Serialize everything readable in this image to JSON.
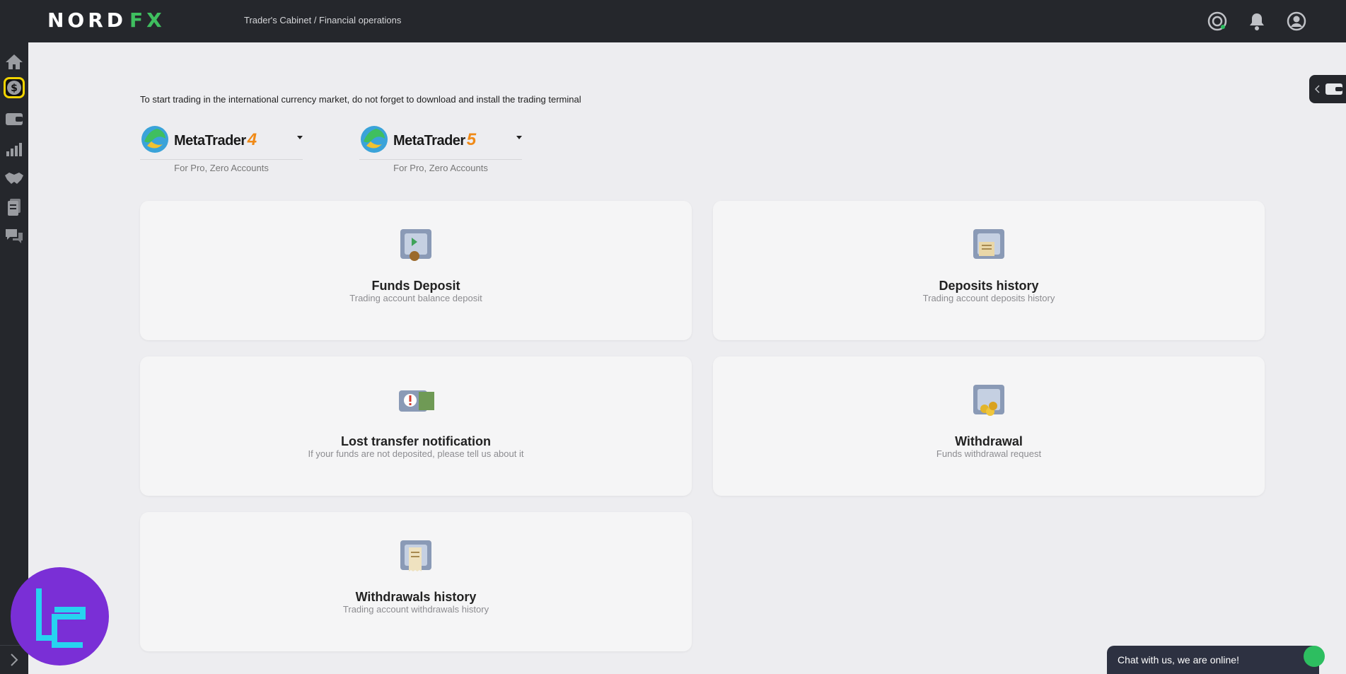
{
  "header": {
    "logo_main": "NORD",
    "logo_accent": "FX",
    "breadcrumb": "Trader's Cabinet / Financial operations",
    "icons": [
      "support-icon",
      "bell-icon",
      "user-icon"
    ]
  },
  "sidebar": {
    "items": [
      {
        "name": "home-icon",
        "active": false
      },
      {
        "name": "dollar-icon",
        "active": true
      },
      {
        "name": "wallet-icon",
        "active": false
      },
      {
        "name": "chart-icon",
        "active": false
      },
      {
        "name": "handshake-icon",
        "active": false
      },
      {
        "name": "documents-icon",
        "active": false
      },
      {
        "name": "chat-icon",
        "active": false
      }
    ],
    "expand_icon": "chevron-right-icon",
    "highlight_color": "#f2d400"
  },
  "main": {
    "intro": "To start trading in the international currency market, do not forget to download and install the trading terminal",
    "terminals": [
      {
        "name": "MetaTrader",
        "version": "4",
        "subtitle": "For Pro, Zero Accounts"
      },
      {
        "name": "MetaTrader",
        "version": "5",
        "subtitle": "For Pro, Zero Accounts"
      }
    ],
    "cards": [
      {
        "title": "Funds Deposit",
        "subtitle": "Trading account balance deposit",
        "icon": "safe-deposit-icon"
      },
      {
        "title": "Deposits history",
        "subtitle": "Trading account deposits history",
        "icon": "safe-documents-icon"
      },
      {
        "title": "Lost transfer notification",
        "subtitle": "If your funds are not deposited, please tell us about it",
        "icon": "safe-alert-icon"
      },
      {
        "title": "Withdrawal",
        "subtitle": "Funds withdrawal request",
        "icon": "safe-coins-icon"
      },
      {
        "title": "Withdrawals history",
        "subtitle": "Trading account withdrawals history",
        "icon": "safe-receipt-icon"
      }
    ]
  },
  "chat": {
    "label": "Chat with us, we are online!"
  },
  "colors": {
    "topbar": "#25272c",
    "accent_green": "#3fbf5f",
    "mt_version": "#f08a17",
    "chat_bg": "#2d3141"
  }
}
